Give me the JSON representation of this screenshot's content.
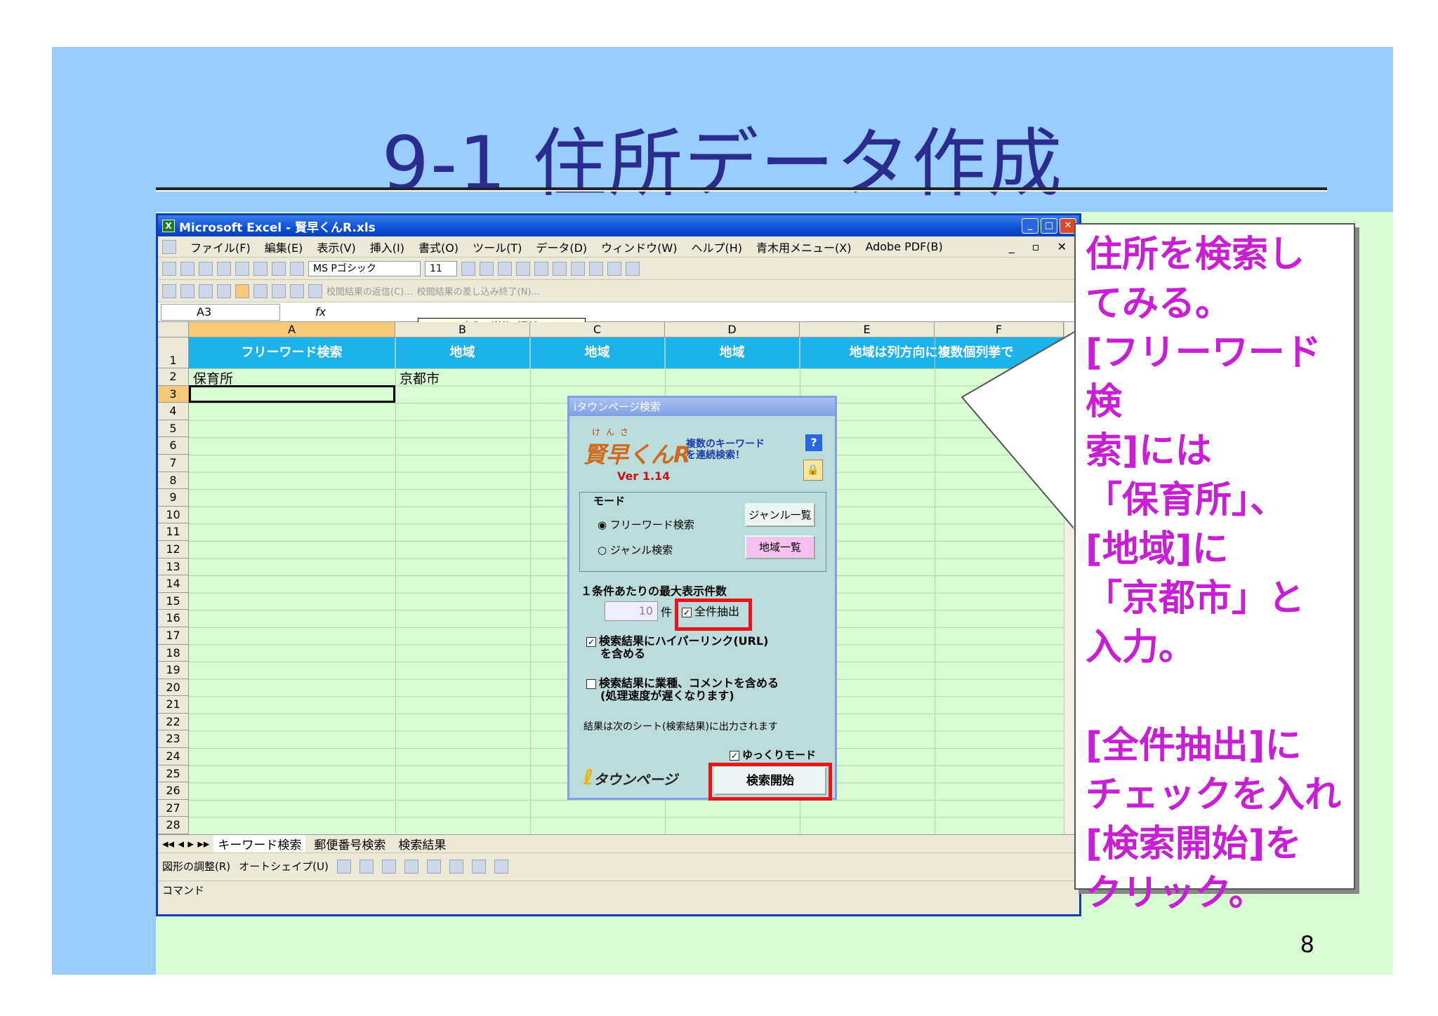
{
  "slide": {
    "title": "9-1 住所データ作成",
    "page_number": "8",
    "colors": {
      "background": "#99ccff",
      "panel": "#d9fbd3",
      "title": "#2b2c8f",
      "callout_text": "#c81ed4",
      "highlight": "#e8141a"
    }
  },
  "excel": {
    "window_title": "Microsoft Excel - 賢早くんR.xls",
    "menu": [
      "ファイル(F)",
      "編集(E)",
      "表示(V)",
      "挿入(I)",
      "書式(O)",
      "ツール(T)",
      "データ(D)",
      "ウィンドウ(W)",
      "ヘルプ(H)",
      "青木用メニュー(X)",
      "Adobe PDF(B)"
    ],
    "font_name": "MS Pゴシック",
    "font_size": "11",
    "review_toolbar": [
      "校閲結果の返信(C)...",
      "校閲結果の差し込み終了(N)..."
    ],
    "tooltip": "メールの宛先に送信 (添付ファイル)",
    "name_box": "A3",
    "fx": "fx",
    "columns": [
      "A",
      "B",
      "C",
      "D",
      "E",
      "F"
    ],
    "header_row": [
      "フリーワード検索",
      "地域",
      "地域",
      "地域",
      "地域は列方向に複数個列挙で"
    ],
    "cells": {
      "A2": "保育所",
      "B2": "京都市"
    },
    "rows": [
      "1",
      "2",
      "3",
      "4",
      "5",
      "6",
      "7",
      "8",
      "9",
      "10",
      "11",
      "12",
      "13",
      "14",
      "15",
      "16",
      "17",
      "18",
      "19",
      "20",
      "21",
      "22",
      "23",
      "24",
      "25",
      "26",
      "27",
      "28"
    ],
    "sheet_tabs": [
      "キーワード検索",
      "郵便番号検索",
      "検索結果"
    ],
    "draw_toolbar": [
      "図形の調整(R)",
      "オートシェイプ(U)"
    ],
    "status": "コマンド"
  },
  "dialog": {
    "title": "iタウンページ検索",
    "logo_ruby": "けんさ",
    "logo": "賢早くんR",
    "tagline_1": "複数のキーワード",
    "tagline_2": "を連続検索！",
    "version": "Ver 1.14",
    "mode_label": "モード",
    "radio_free": "フリーワード検索",
    "radio_genre": "ジャンル検索",
    "genre_list_button": "ジャンル一覧",
    "area_list_button": "地域一覧",
    "max_label": "１条件あたりの最大表示件数",
    "max_value": "10",
    "max_unit": "件",
    "all_extract": "全件抽出",
    "hyperlink_1": "検索結果にハイパーリンク(URL)",
    "hyperlink_2": "を含める",
    "comment_1": "検索結果に業種、コメントを含める",
    "comment_2": "(処理速度が遅くなります)",
    "note": "結果は次のシート(検索結果)に出力されます",
    "slow_mode": "ゆっくりモード",
    "brand": "タウンページ",
    "start_button": "検索開始"
  },
  "callout": {
    "text": "住所を検索し\nてみる。\n[フリーワード検\n索]には\n「保育所」、\n[地域]に\n「京都市」と\n入力。\n\n[全件抽出]に\nチェックを入れ\n[検索開始]を\nクリック。"
  }
}
